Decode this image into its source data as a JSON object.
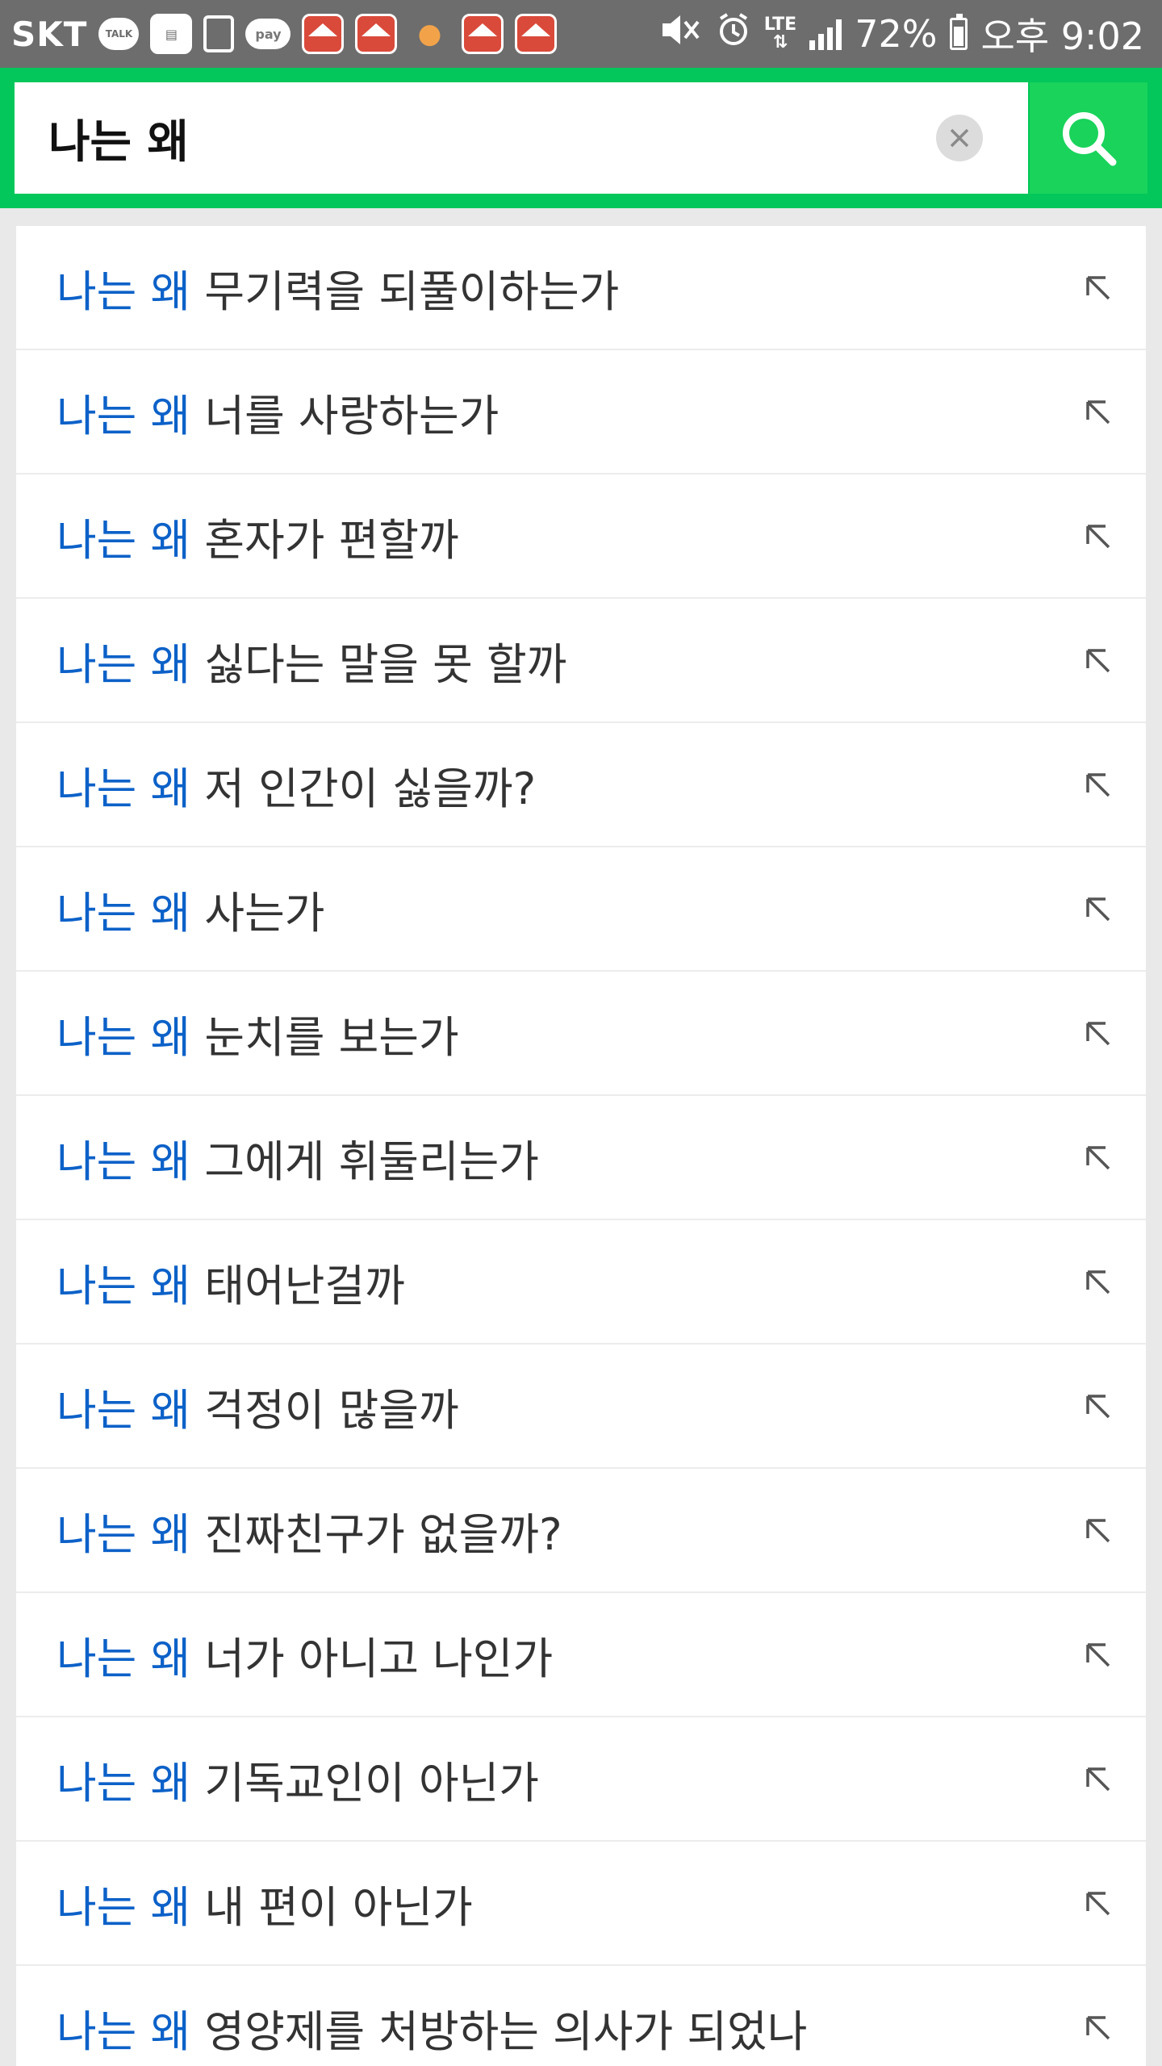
{
  "status_bar": {
    "carrier": "SKT",
    "icons": [
      "kakaotalk-icon",
      "inbox-icon",
      "device-icon",
      "pay-icon",
      "home-app-icon",
      "home-app-icon",
      "coins-icon",
      "home-app-icon",
      "home-app-icon",
      "mute-icon",
      "alarm-icon",
      "lte-icon",
      "signal-icon",
      "battery-icon"
    ],
    "talk_label": "TALK",
    "pay_label": "pay",
    "lte_label": "LTE",
    "battery": "72%",
    "time": "오후 9:02"
  },
  "search": {
    "query": "나는 왜",
    "accent_color": "#03c75a",
    "button_color": "#19d35b"
  },
  "suggestions": [
    {
      "highlight": "나는 왜",
      "rest": " 무기력을 되풀이하는가"
    },
    {
      "highlight": "나는 왜",
      "rest": " 너를 사랑하는가"
    },
    {
      "highlight": "나는 왜",
      "rest": " 혼자가 편할까"
    },
    {
      "highlight": "나는 왜",
      "rest": " 싫다는 말을 못 할까"
    },
    {
      "highlight": "나는 왜",
      "rest": " 저 인간이 싫을까?"
    },
    {
      "highlight": "나는 왜",
      "rest": " 사는가"
    },
    {
      "highlight": "나는 왜",
      "rest": " 눈치를 보는가"
    },
    {
      "highlight": "나는 왜",
      "rest": " 그에게 휘둘리는가"
    },
    {
      "highlight": "나는 왜",
      "rest": " 태어난걸까"
    },
    {
      "highlight": "나는 왜",
      "rest": " 걱정이 많을까"
    },
    {
      "highlight": "나는 왜",
      "rest": " 진짜친구가 없을까?"
    },
    {
      "highlight": "나는 왜",
      "rest": " 너가 아니고 나인가"
    },
    {
      "highlight": "나는 왜",
      "rest": " 기독교인이 아닌가"
    },
    {
      "highlight": "나는 왜",
      "rest": " 내 편이 아닌가"
    },
    {
      "highlight": "나는 왜",
      "rest": " 영양제를 처방하는 의사가 되었나"
    }
  ],
  "colors": {
    "highlight": "#0c61c8",
    "text": "#333333"
  }
}
